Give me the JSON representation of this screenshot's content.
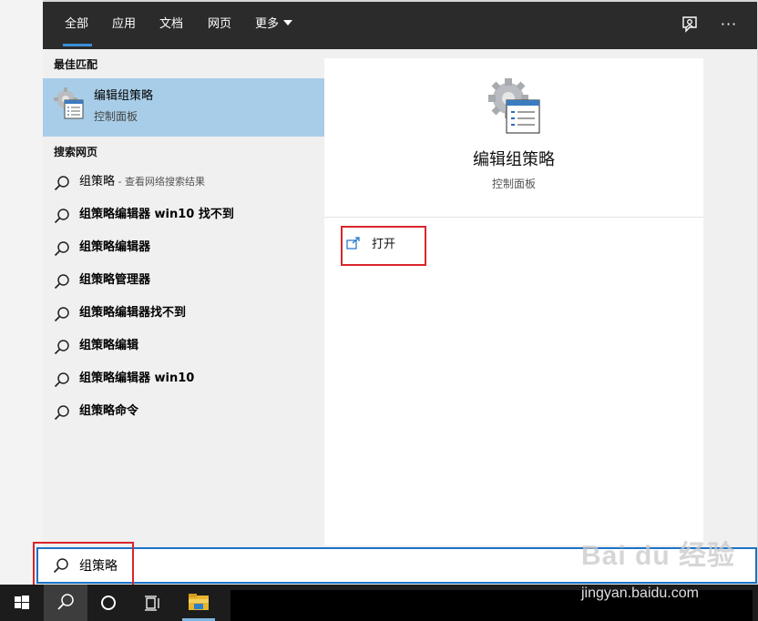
{
  "tabs": {
    "all": "全部",
    "apps": "应用",
    "docs": "文档",
    "web": "网页",
    "more": "更多"
  },
  "topbar_icons": {
    "feedback": "feedback-icon",
    "more": "···"
  },
  "best_match": {
    "header": "最佳匹配",
    "title": "编辑组策略",
    "subtitle": "控制面板",
    "icon": "group-policy-icon"
  },
  "web_search": {
    "header": "搜索网页",
    "items": [
      {
        "text": "组策略",
        "suffix": " - 查看网络搜索结果"
      },
      {
        "text": "组策略编辑器 win10 找不到",
        "suffix": ""
      },
      {
        "text": "组策略编辑器",
        "suffix": ""
      },
      {
        "text": "组策略管理器",
        "suffix": ""
      },
      {
        "text": "组策略编辑器找不到",
        "suffix": ""
      },
      {
        "text": "组策略编辑",
        "suffix": ""
      },
      {
        "text": "组策略编辑器 win10",
        "suffix": ""
      },
      {
        "text": "组策略命令",
        "suffix": ""
      }
    ]
  },
  "detail": {
    "title": "编辑组策略",
    "subtitle": "控制面板",
    "open_label": "打开"
  },
  "search": {
    "value": "组策略"
  },
  "taskbar": [
    "windows-start-icon",
    "search-icon",
    "cortana-icon",
    "task-view-icon",
    "file-explorer-icon"
  ],
  "watermark": {
    "logo": "Bai du 经验",
    "url": "jingyan.baidu.com"
  },
  "colors": {
    "accent": "#1a73c8",
    "selected": "#a8cde8",
    "highlight_box": "#d9262c",
    "topbar": "#2b2b2b"
  }
}
